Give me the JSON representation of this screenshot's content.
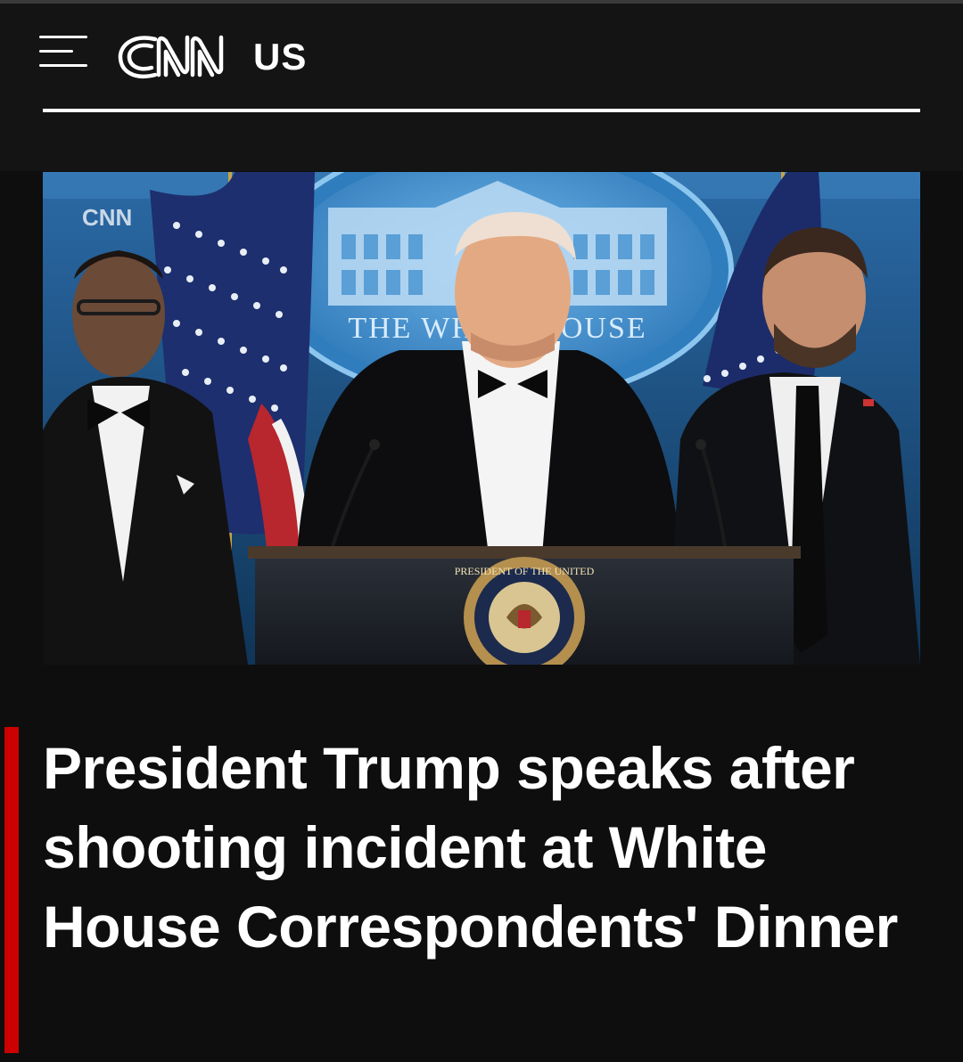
{
  "header": {
    "brand": "CNN",
    "edition_label": "US"
  },
  "media": {
    "watermark": "CNN",
    "backdrop_text": "THE WHITE HOUSE",
    "seal_text": "PRESIDENT OF THE UNITED STATES",
    "icons": [
      "menu-icon",
      "cnn-logo",
      "presidential-seal-icon"
    ]
  },
  "article": {
    "headline": "President Trump speaks after shooting incident at White House Correspondents' Dinner"
  },
  "colors": {
    "background": "#0e0e0e",
    "header_background": "#141414",
    "accent": "#cc0000",
    "text": "#ffffff"
  }
}
